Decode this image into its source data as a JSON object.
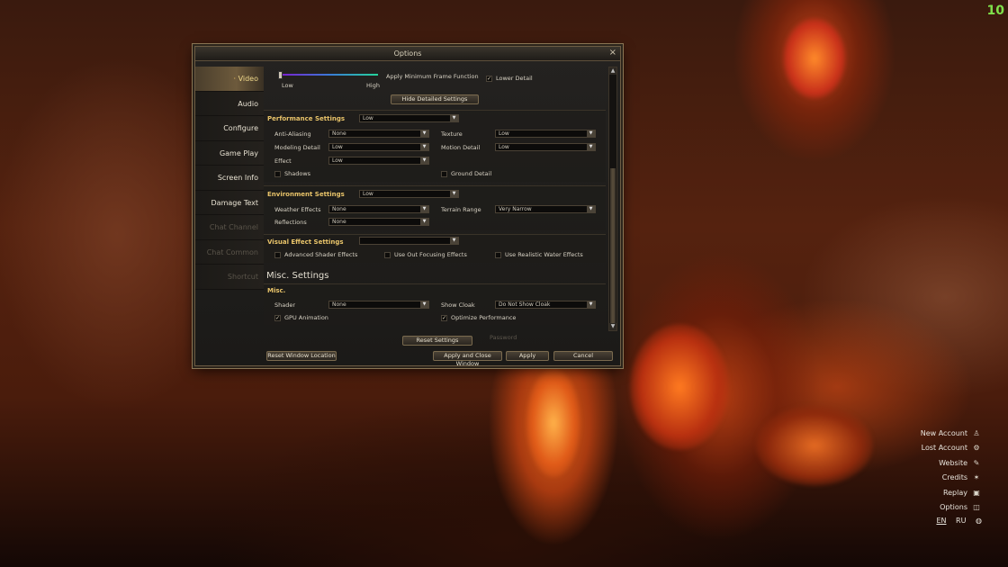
{
  "counter": "10",
  "window": {
    "title": "Options",
    "close_icon": "×"
  },
  "sidebar": {
    "items": [
      {
        "label": "Video",
        "state": "active"
      },
      {
        "label": "Audio",
        "state": "normal"
      },
      {
        "label": "Configure",
        "state": "normal"
      },
      {
        "label": "Game Play",
        "state": "normal"
      },
      {
        "label": "Screen Info",
        "state": "normal"
      },
      {
        "label": "Damage Text",
        "state": "normal"
      },
      {
        "label": "Chat Channel",
        "state": "disabled"
      },
      {
        "label": "Chat Common",
        "state": "disabled"
      },
      {
        "label": "Shortcut",
        "state": "disabled"
      }
    ]
  },
  "video": {
    "slider": {
      "low": "Low",
      "high": "High",
      "value_fraction": 0.0
    },
    "apply_min_frame": "Apply Minimum Frame Function",
    "lower_detail": {
      "label": "Lower Detail",
      "checked": true
    },
    "hide_detailed_button": "Hide Detailed Settings",
    "performance": {
      "title": "Performance Settings",
      "preset": "Low",
      "anti_aliasing": {
        "label": "Anti-Aliasing",
        "value": "None"
      },
      "texture": {
        "label": "Texture",
        "value": "Low"
      },
      "modeling_detail": {
        "label": "Modeling Detail",
        "value": "Low"
      },
      "motion_detail": {
        "label": "Motion Detail",
        "value": "Low"
      },
      "effect": {
        "label": "Effect",
        "value": "Low"
      },
      "shadows": {
        "label": "Shadows",
        "checked": false
      },
      "ground_detail": {
        "label": "Ground Detail",
        "checked": false
      }
    },
    "environment": {
      "title": "Environment Settings",
      "preset": "Low",
      "weather": {
        "label": "Weather Effects",
        "value": "None"
      },
      "terrain": {
        "label": "Terrain Range",
        "value": "Very Narrow"
      },
      "reflections": {
        "label": "Reflections",
        "value": "None"
      }
    },
    "visual": {
      "title": "Visual Effect Settings",
      "preset": "",
      "advanced_shader": {
        "label": "Advanced Shader Effects",
        "checked": false
      },
      "out_focusing": {
        "label": "Use Out Focusing Effects",
        "checked": false
      },
      "realistic_water": {
        "label": "Use Realistic Water Effects",
        "checked": false
      }
    },
    "misc": {
      "header": "Misc. Settings",
      "title": "Misc.",
      "shader": {
        "label": "Shader",
        "value": "None"
      },
      "show_cloak": {
        "label": "Show Cloak",
        "value": "Do Not Show Cloak"
      },
      "gpu_animation": {
        "label": "GPU Animation",
        "checked": true
      },
      "optimize": {
        "label": "Optimize Performance",
        "checked": true
      }
    },
    "reset_button": "Reset Settings",
    "password_ghost": "Password"
  },
  "footer": {
    "reset_location": "Reset Window Location",
    "apply_close": "Apply and Close Window",
    "apply": "Apply",
    "cancel": "Cancel"
  },
  "right_menu": [
    {
      "label": "New Account",
      "icon": "person-icon"
    },
    {
      "label": "Lost Account",
      "icon": "gear-icon"
    },
    {
      "label": "Website",
      "icon": "feather-icon"
    },
    {
      "label": "Credits",
      "icon": "star-icon"
    },
    {
      "label": "Replay",
      "icon": "film-icon"
    },
    {
      "label": "Options",
      "icon": "settings-icon"
    }
  ],
  "languages": {
    "en": "EN",
    "ru": "RU",
    "active": "EN",
    "icon": "globe-icon"
  },
  "colors": {
    "accent": "#e9c46a",
    "counter": "#7fe04a"
  }
}
